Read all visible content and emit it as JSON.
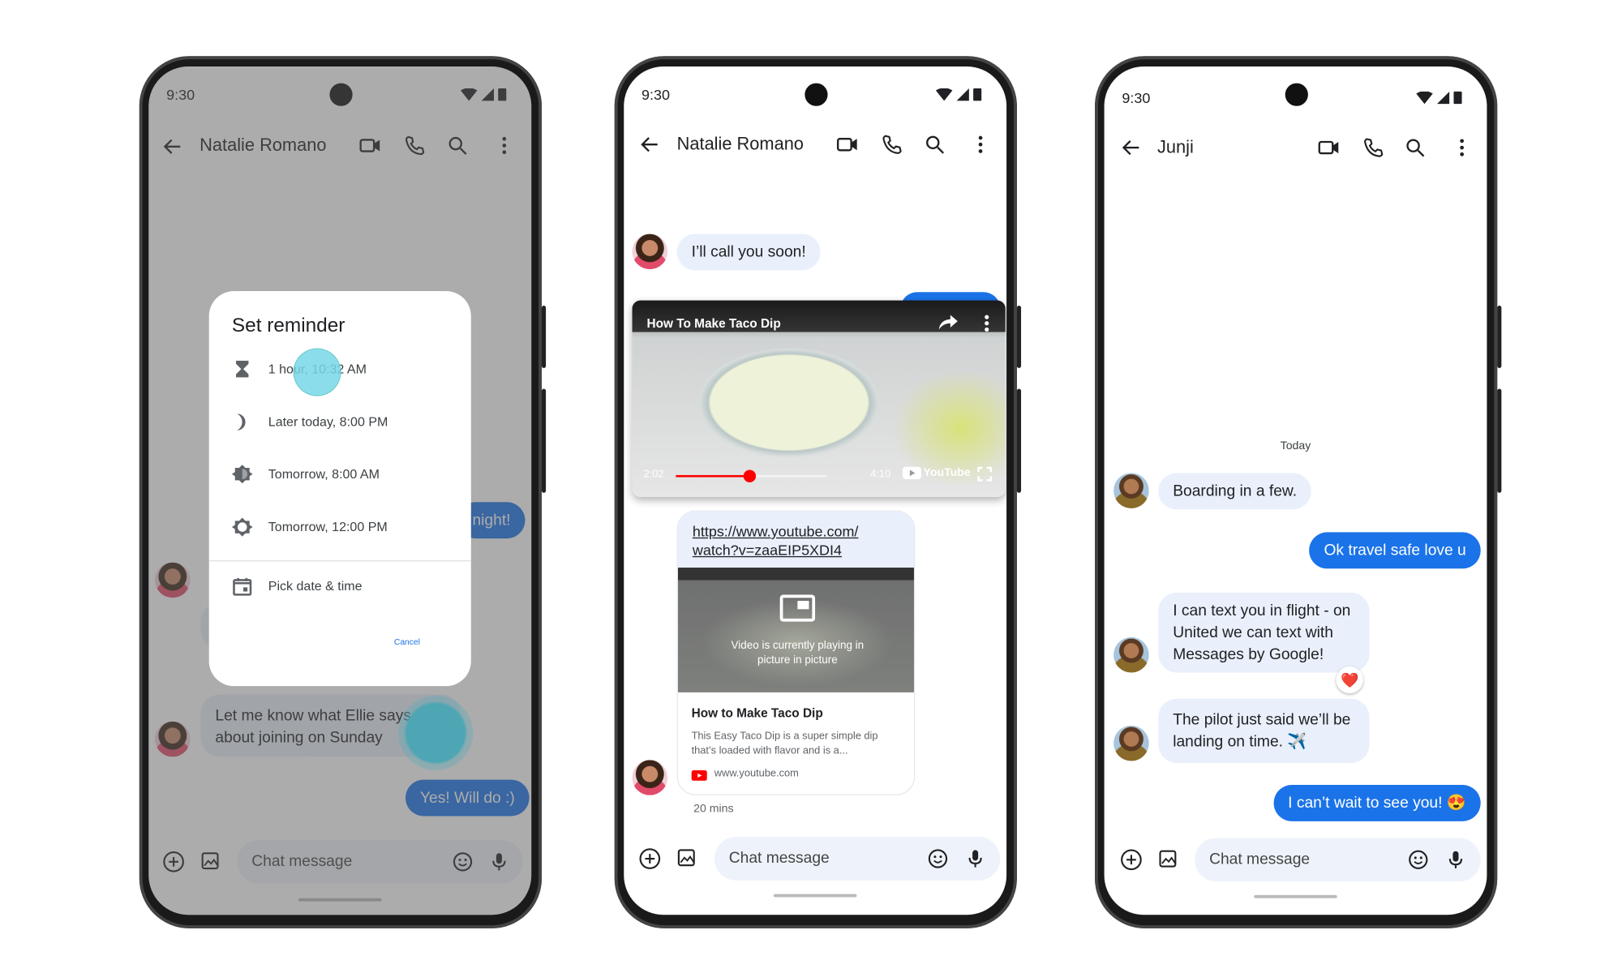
{
  "status_time": "9:30",
  "phone1": {
    "contact_name": "Natalie Romano",
    "dialog": {
      "title": "Set reminder",
      "options": [
        {
          "label": "1 hour, 10:32 AM",
          "icon": "hourglass-icon"
        },
        {
          "label": "Later today, 8:00 PM",
          "icon": "moon-icon"
        },
        {
          "label": "Tomorrow, 8:00 AM",
          "icon": "sunrise-icon"
        },
        {
          "label": "Tomorrow, 12:00 PM",
          "icon": "sun-icon"
        },
        {
          "label": "Pick date & time",
          "icon": "calendar-icon"
        }
      ],
      "cancel_label": "Cancel"
    },
    "messages": [
      {
        "text": "night!",
        "direction": "outgoing"
      },
      {
        "text": "Let me know what Ellie says about joining on Sunday",
        "direction": "incoming"
      },
      {
        "text": "Yes! Will do :)",
        "direction": "outgoing"
      }
    ],
    "composer_placeholder": "Chat message"
  },
  "phone2": {
    "contact_name": "Natalie Romano",
    "messages": [
      {
        "text": "I’ll call you soon!",
        "direction": "incoming"
      }
    ],
    "pip_video": {
      "title": "How To Make Taco Dip",
      "elapsed": "2:02",
      "duration": "4:10",
      "progress": 0.49,
      "brand": "YouTube"
    },
    "link_card": {
      "url_line1": "https://www.youtube.com/",
      "url_line2": "watch?v=zaaEIP5XDI4",
      "pip_notice": "Video is currently playing in picture in picture",
      "title": "How to Make Taco Dip",
      "description": "This Easy Taco Dip is a super simple dip that’s loaded with flavor and is a...",
      "domain": "www.youtube.com"
    },
    "timestamp": "20 mins",
    "composer_placeholder": "Chat message"
  },
  "phone3": {
    "contact_name": "Junji",
    "date_divider": "Today",
    "messages": [
      {
        "text": "Boarding in a few.",
        "direction": "incoming"
      },
      {
        "text": "Ok travel safe love u",
        "direction": "outgoing"
      },
      {
        "text": "I can text you in flight - on United we can text with Messages by Google!",
        "direction": "incoming",
        "reaction": "❤️"
      },
      {
        "text": "The pilot just said we’ll be landing on time. ✈️",
        "direction": "incoming"
      },
      {
        "text": "I can’t wait to see you! 😍",
        "direction": "outgoing"
      }
    ],
    "composer_placeholder": "Chat message"
  },
  "colors": {
    "accent": "#1a73e8",
    "incoming_bubble": "#e9f0fb",
    "youtube_red": "#ff0000"
  }
}
